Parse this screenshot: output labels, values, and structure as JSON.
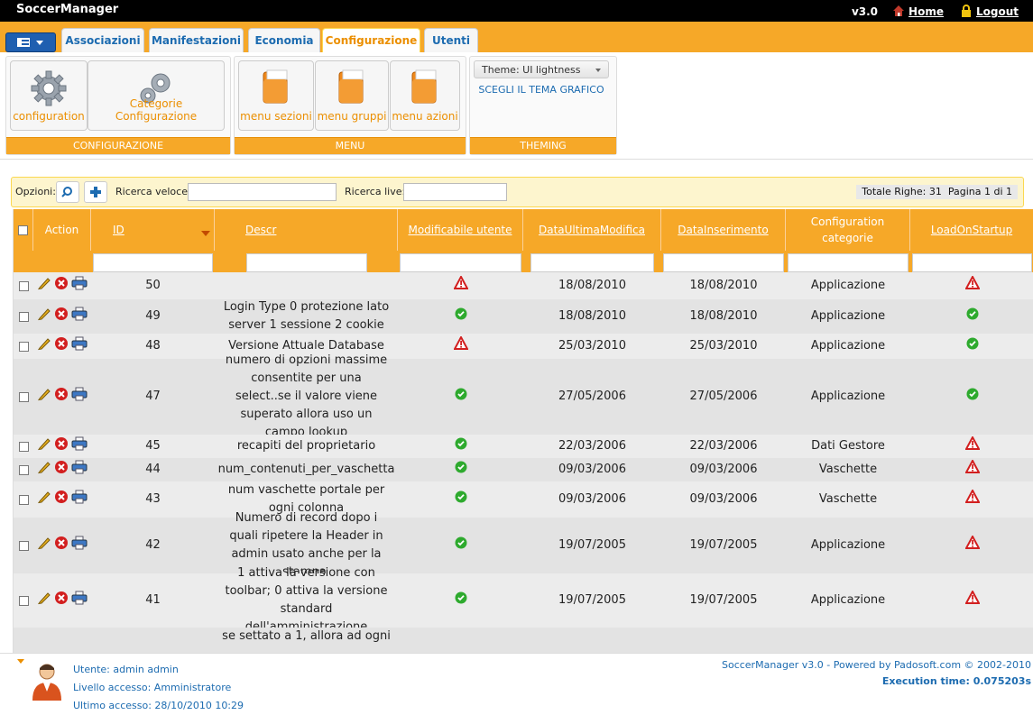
{
  "app": {
    "title": "SoccerManager",
    "version": "v3.0",
    "home_label": "Home",
    "logout_label": "Logout"
  },
  "tabs": [
    {
      "label": "Associazioni",
      "active": false
    },
    {
      "label": "Manifestazioni",
      "active": false
    },
    {
      "label": "Economia",
      "active": false
    },
    {
      "label": "Configurazione",
      "active": true
    },
    {
      "label": "Utenti",
      "active": false
    }
  ],
  "ribbon": {
    "groups": [
      {
        "title": "CONFIGURAZIONE",
        "buttons": [
          {
            "label": "configuration",
            "icon": "gear-icon"
          },
          {
            "label": "Categorie Configurazione",
            "icon": "gears-icon"
          }
        ]
      },
      {
        "title": "MENU",
        "buttons": [
          {
            "label": "menu sezioni",
            "icon": "folder-icon"
          },
          {
            "label": "menu gruppi",
            "icon": "folder-icon"
          },
          {
            "label": "menu azioni",
            "icon": "folder-icon"
          }
        ]
      },
      {
        "title": "THEMING",
        "theme_select": "Theme: UI lightness",
        "theme_link": "SCEGLI IL TEMA GRAFICO"
      }
    ]
  },
  "options": {
    "label": "Opzioni:",
    "quick_search_label": "Ricerca veloce:",
    "live_search_label": "Ricerca live:",
    "totals": "Totale Righe: 31",
    "page": "Pagina 1 di 1"
  },
  "grid": {
    "headers": {
      "action": "Action",
      "id": "ID",
      "descr": "Descr",
      "modificabile": "Modificabile utente",
      "data_ultima": "DataUltimaModifica",
      "data_ins": "DataInserimento",
      "categorie": "Configuration categorie",
      "load": "LoadOnStartup"
    },
    "rows": [
      {
        "id": "50",
        "descr": "",
        "mod": "warning",
        "dum": "18/08/2010",
        "di": "18/08/2010",
        "cat": "Applicazione",
        "load": "warning",
        "bold": false
      },
      {
        "id": "49",
        "descr": "Login Type 0 protezione lato server 1 sessione 2 cookie",
        "mod": "ok",
        "dum": "18/08/2010",
        "di": "18/08/2010",
        "cat": "Applicazione",
        "load": "ok",
        "bold": true
      },
      {
        "id": "48",
        "descr": "Versione Attuale Database",
        "mod": "warning",
        "dum": "25/03/2010",
        "di": "25/03/2010",
        "cat": "Applicazione",
        "load": "ok",
        "bold": false
      },
      {
        "id": "47",
        "descr": "numero di opzioni massime consentite per una select..se il valore viene superato allora uso un campo lookup",
        "mod": "ok",
        "dum": "27/05/2006",
        "di": "27/05/2006",
        "cat": "Applicazione",
        "load": "ok",
        "bold": true
      },
      {
        "id": "45",
        "descr": "recapiti del proprietario",
        "mod": "ok",
        "dum": "22/03/2006",
        "di": "22/03/2006",
        "cat": "Dati Gestore",
        "load": "warning",
        "bold": false
      },
      {
        "id": "44",
        "descr": "num_contenuti_per_vaschetta",
        "mod": "ok",
        "dum": "09/03/2006",
        "di": "09/03/2006",
        "cat": "Vaschette",
        "load": "warning",
        "bold": true
      },
      {
        "id": "43",
        "descr": "num vaschette portale per ogni colonna",
        "mod": "ok",
        "dum": "09/03/2006",
        "di": "09/03/2006",
        "cat": "Vaschette",
        "load": "warning",
        "bold": false
      },
      {
        "id": "42",
        "descr": "Numero di record dopo i quali ripetere la Header in admin usato anche per la stampa.",
        "mod": "ok",
        "dum": "19/07/2005",
        "di": "19/07/2005",
        "cat": "Applicazione",
        "load": "warning",
        "bold": true
      },
      {
        "id": "41",
        "descr": "1 attiva la versione con toolbar; 0 attiva la versione standard dell'amministrazione",
        "mod": "ok",
        "dum": "19/07/2005",
        "di": "19/07/2005",
        "cat": "Applicazione",
        "load": "warning",
        "bold": false
      },
      {
        "id": "",
        "descr": "se settato a 1, allora ad ogni",
        "mod": "",
        "dum": "",
        "di": "",
        "cat": "",
        "load": "",
        "bold": true
      }
    ]
  },
  "footer": {
    "user": "Utente: admin admin",
    "level": "Livello accesso: Amministratore",
    "last_access": "Ultimo accesso: 28/10/2010 10:29",
    "credits": "SoccerManager v3.0 - Powered by Padosoft.com © 2002-2010",
    "exec_time": "Execution time: 0.075203s"
  },
  "colors": {
    "accent": "#f6a828",
    "link": "#1c6bb0",
    "ok": "#2eaa2e",
    "warning": "#d21f1f"
  }
}
